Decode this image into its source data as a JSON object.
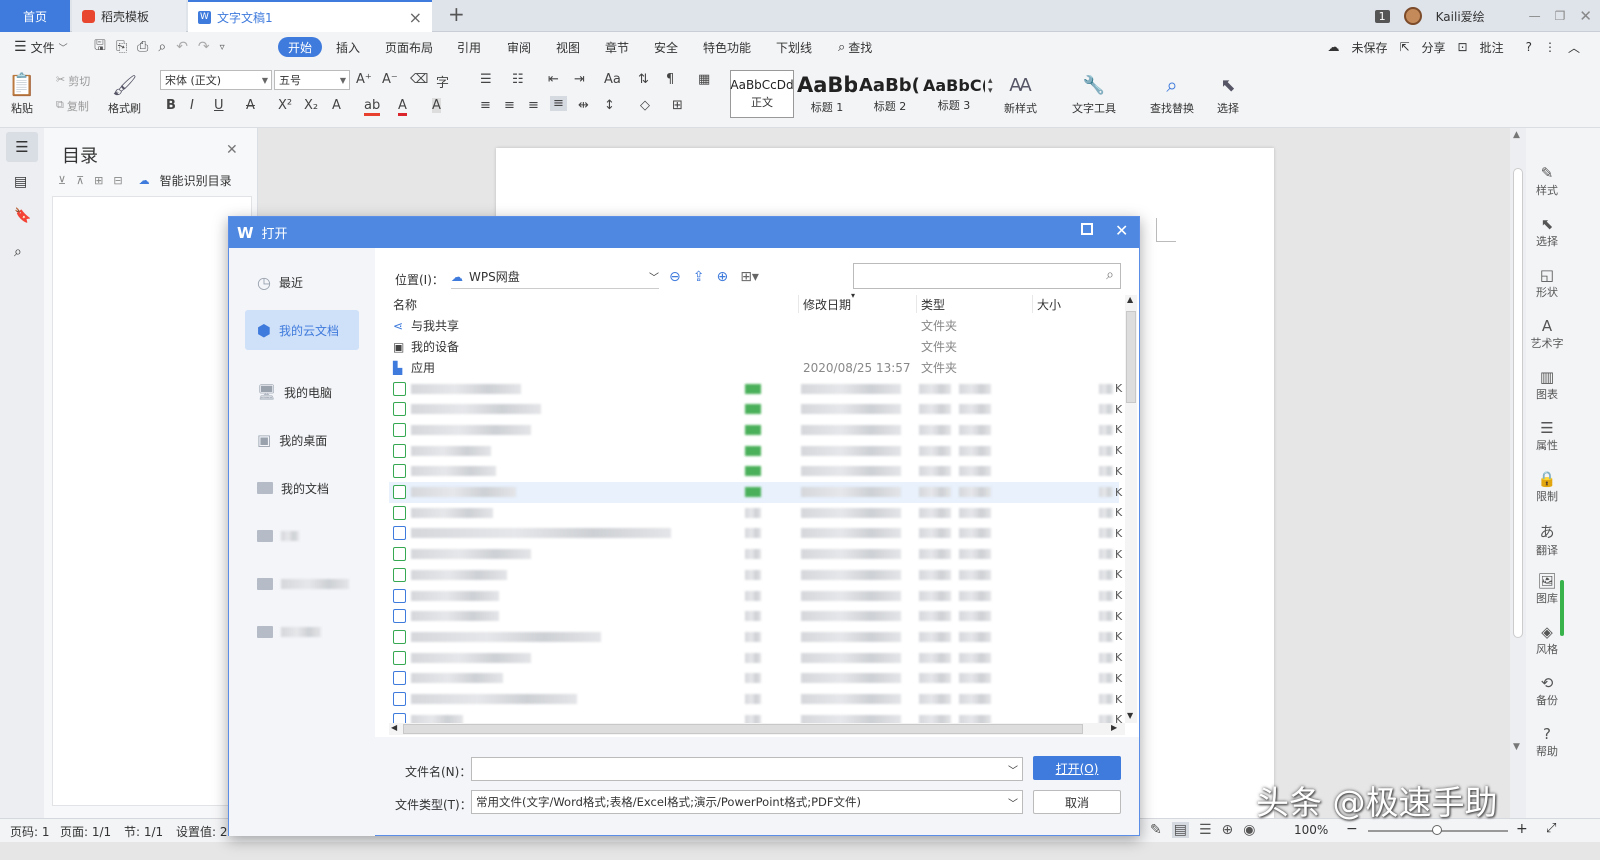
{
  "tabs": {
    "home": "首页",
    "template": "稻壳模板",
    "document": "文字文稿1"
  },
  "titlebar": {
    "page_badge": "1",
    "user": "Kaili爱绘"
  },
  "menu": {
    "file": "文件",
    "items": [
      "开始",
      "插入",
      "页面布局",
      "引用",
      "审阅",
      "视图",
      "章节",
      "安全",
      "特色功能",
      "下划线"
    ],
    "search": "查找",
    "unsaved": "未保存",
    "share": "分享",
    "comment": "批注"
  },
  "ribbon": {
    "paste": "粘贴",
    "cut": "剪切",
    "copy": "复制",
    "format_painter": "格式刷",
    "font": "宋体 (正文)",
    "size": "五号",
    "styles": [
      {
        "preview": "AaBbCcDd",
        "label": "正文"
      },
      {
        "preview": "AaBb",
        "label": "标题 1"
      },
      {
        "preview": "AaBb(",
        "label": "标题 2"
      },
      {
        "preview": "AaBbC(",
        "label": "标题 3"
      }
    ],
    "new_style": "新样式",
    "text_tools": "文字工具",
    "find_replace": "查找替换",
    "select": "选择"
  },
  "toc": {
    "title": "目录",
    "smart": "智能识别目录"
  },
  "right_rail": [
    "样式",
    "选择",
    "形状",
    "艺术字",
    "图表",
    "属性",
    "限制",
    "翻译",
    "图库",
    "风格",
    "备份",
    "帮助"
  ],
  "dialog": {
    "title": "打开",
    "sidebar": {
      "recent": "最近",
      "cloud": "我的云文档",
      "computer": "我的电脑",
      "desktop": "我的桌面",
      "documents": "我的文档"
    },
    "location_label": "位置(I)：",
    "location_value": "WPS网盘",
    "columns": {
      "name": "名称",
      "date": "修改日期",
      "type": "类型",
      "size": "大小"
    },
    "rows": [
      {
        "name": "与我共享",
        "date": "",
        "type": "文件夹"
      },
      {
        "name": "我的设备",
        "date": "",
        "type": "文件夹"
      },
      {
        "name": "应用",
        "date": "2020/08/25 13:57",
        "type": "文件夹"
      }
    ],
    "filename_label": "文件名(N)：",
    "filetype_label": "文件类型(T)：",
    "filetype_value": "常用文件(文字/Word格式;表格/Excel格式;演示/PowerPoint格式;PDF文件)",
    "open_button": "打开(O)",
    "cancel_button": "取消"
  },
  "statusbar": {
    "page_num": "页码: 1",
    "pages": "页面: 1/1",
    "section": "节: 1/1",
    "settings": "设置值: 2.",
    "zoom": "100%"
  },
  "watermark": "头条 @极速手助"
}
